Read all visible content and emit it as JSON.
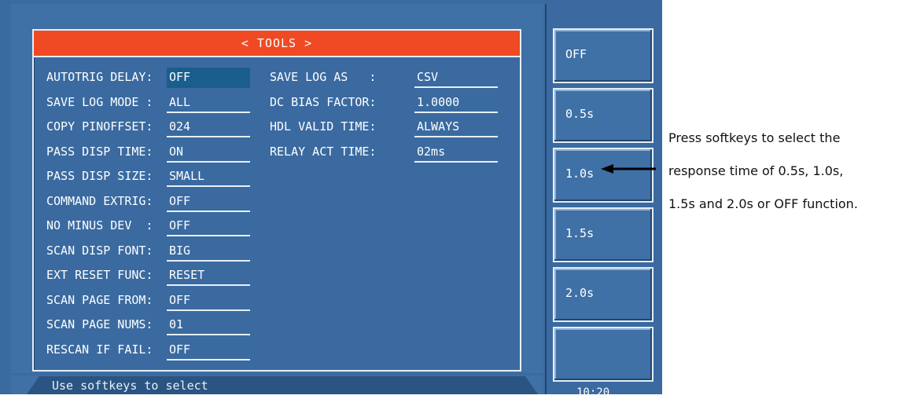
{
  "window": {
    "title": "< TOOLS >"
  },
  "left_fields": [
    {
      "label": "AUTOTRIG DELAY: ",
      "value": "OFF",
      "selected": true
    },
    {
      "label": "SAVE LOG MODE : ",
      "value": "ALL"
    },
    {
      "label": "COPY PINOFFSET: ",
      "value": "024"
    },
    {
      "label": "PASS DISP TIME: ",
      "value": "ON"
    },
    {
      "label": "PASS DISP SIZE: ",
      "value": "SMALL"
    },
    {
      "label": "COMMAND EXTRIG: ",
      "value": "OFF"
    },
    {
      "label": "NO MINUS DEV  : ",
      "value": "OFF"
    },
    {
      "label": "SCAN DISP FONT: ",
      "value": "BIG"
    },
    {
      "label": "EXT RESET FUNC: ",
      "value": "RESET"
    },
    {
      "label": "SCAN PAGE FROM: ",
      "value": "OFF"
    },
    {
      "label": "SCAN PAGE NUMS: ",
      "value": "01"
    },
    {
      "label": "RESCAN IF FAIL: ",
      "value": "OFF"
    }
  ],
  "right_fields": [
    {
      "label": "SAVE LOG AS   : ",
      "value": "CSV"
    },
    {
      "label": "DC BIAS FACTOR: ",
      "value": "1.0000"
    },
    {
      "label": "HDL VALID TIME: ",
      "value": "ALWAYS"
    },
    {
      "label": "RELAY ACT TIME: ",
      "value": "02ms"
    }
  ],
  "status": "Use softkeys to select",
  "softkeys": [
    "OFF",
    "0.5s",
    "1.0s",
    "1.5s",
    "2.0s",
    ""
  ],
  "clock": "10:20",
  "note": {
    "line1": "Press softkeys to select the",
    "line2": "response time of 0.5s, 1.0s,",
    "line3": "1.5s and 2.0s or OFF function."
  },
  "colors": {
    "screen_bg": "#3a6aa0",
    "title_bar": "#f04a24",
    "selected_field": "#1a5e8e"
  }
}
